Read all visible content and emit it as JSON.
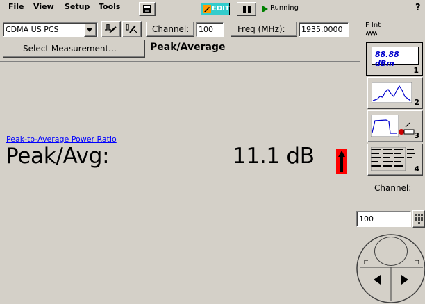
{
  "menu": {
    "file": "File",
    "view": "View",
    "setup": "Setup",
    "tools": "Tools",
    "edit_label": "EDIT",
    "status": "Running",
    "help": "?"
  },
  "toolbar": {
    "standard": "CDMA US PCS",
    "channel_label": "Channel:",
    "channel_value": "100",
    "freq_label": "Freq (MHz):",
    "freq_value": "1935.0000",
    "fint_label": "F Int"
  },
  "measurement": {
    "select_button": "Select Measurement...",
    "title": "Peak/Average",
    "link": "Peak-to-Average Power Ratio",
    "result_label": "Peak/Avg:",
    "result_value": "11.1 dB"
  },
  "side": {
    "btn1_display": "88.88 dBm",
    "btn1_num": "1",
    "btn2_num": "2",
    "btn3_num": "3",
    "btn4_num": "4",
    "channel_label": "Channel:",
    "channel_value": "100"
  },
  "colors": {
    "indicator": "#ff0000",
    "link": "#0000ff",
    "edit_bg": "#33cccc",
    "play": "#008000"
  }
}
